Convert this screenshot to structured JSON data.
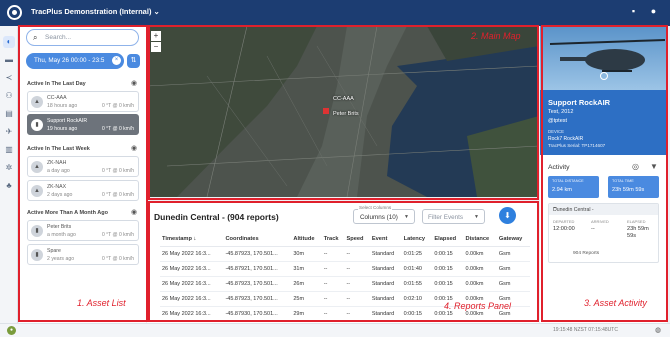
{
  "app": {
    "title": "TracPlus Demonstration (Internal) ⌄"
  },
  "search": {
    "placeholder": "Search..."
  },
  "date_filter": {
    "label": "Thu, May 26 00:00 - 23:5"
  },
  "groups": [
    {
      "label": "Active In The Last Day",
      "assets": [
        {
          "name": "CC-AAA",
          "time": "18 hours ago",
          "status": "0 °T @ 0 km/h",
          "selected": false
        },
        {
          "name": "Support RockAIR",
          "time": "19 hours ago",
          "status": "0 °T @ 0 km/h",
          "selected": true
        }
      ]
    },
    {
      "label": "Active In The Last Week",
      "assets": [
        {
          "name": "ZK-NAH",
          "time": "a day ago",
          "status": "0 °T @ 0 km/h",
          "selected": false
        },
        {
          "name": "ZK-NAX",
          "time": "2 days ago",
          "status": "0 °T @ 0 km/h",
          "selected": false
        }
      ]
    },
    {
      "label": "Active More Than A Month Ago",
      "assets": [
        {
          "name": "Peter Brits",
          "time": "a month ago",
          "status": "0 °T @ 0 km/h",
          "selected": false
        },
        {
          "name": "Spare",
          "time": "2 years ago",
          "status": "0 °T @ 0 km/h",
          "selected": false
        }
      ]
    }
  ],
  "map": {
    "labels": [
      "CC-AAA",
      "Peter Brits"
    ],
    "zoom_in": "+",
    "zoom_out": "−"
  },
  "reports": {
    "title": "Dunedin Central - (904 reports)",
    "columns_select": {
      "label": "Select Columns",
      "value": "Columns (10)"
    },
    "filter_events": {
      "placeholder": "Filter Events"
    },
    "headers": [
      "Timestamp ↓",
      "Coordinates",
      "Altitude",
      "Track",
      "Speed",
      "Event",
      "Latency",
      "Elapsed",
      "Distance",
      "Gateway"
    ],
    "rows": [
      [
        "26 May 2022 16:3...",
        "-45.87923, 170.501...",
        "30m",
        "--",
        "--",
        "Standard",
        "0:01:25",
        "0:00:15",
        "0.00km",
        "Gsm"
      ],
      [
        "26 May 2022 16:3...",
        "-45.87921, 170.501...",
        "31m",
        "--",
        "--",
        "Standard",
        "0:01:40",
        "0:00:15",
        "0.00km",
        "Gsm"
      ],
      [
        "26 May 2022 16:3...",
        "-45.87923, 170.501...",
        "26m",
        "--",
        "--",
        "Standard",
        "0:01:55",
        "0:00:15",
        "0.00km",
        "Gsm"
      ],
      [
        "26 May 2022 16:3...",
        "-45.87923, 170.501...",
        "25m",
        "--",
        "--",
        "Standard",
        "0:02:10",
        "0:00:15",
        "0.00km",
        "Gsm"
      ],
      [
        "26 May 2022 16:3...",
        "-45.87930, 170.501...",
        "29m",
        "--",
        "--",
        "Standard",
        "0:00:15",
        "0:00:15",
        "0.00km",
        "Gsm"
      ]
    ]
  },
  "asset_detail": {
    "name": "Support RockAIR",
    "line1": "Test, 2012",
    "line2": "@tptest",
    "device_label": "DEVICE",
    "device_name": "Rock7 RockAIR",
    "device_serial": "TracPlus Serial: TP1714607"
  },
  "activity": {
    "title": "Activity",
    "total_distance_label": "TOTAL DISTANCE",
    "total_distance": "2.94 km",
    "total_time_label": "TOTAL TIME",
    "total_time": "23h 59m 59s",
    "segment": {
      "title": "Dunedin Central -",
      "departed_label": "DEPARTED",
      "departed": "12:00:00",
      "arrived_label": "ARRIVED",
      "arrived": "--",
      "elapsed_label": "ELAPSED",
      "elapsed": "23h 59m 59s",
      "reports": "904 Reports"
    }
  },
  "footer": {
    "timestamp": "19:15:48 NZST 07:15:48UTC"
  },
  "annotations": {
    "asset_list": "1. Asset List",
    "main_map": "2. Main Map",
    "asset_activity": "3. Asset Activity",
    "reports_panel": "4. Reports Panel"
  },
  "colors": {
    "nav": "#1c3d72",
    "accent": "#2f80de",
    "annotation": "#e0202c",
    "selected_asset": "#6d737b"
  }
}
